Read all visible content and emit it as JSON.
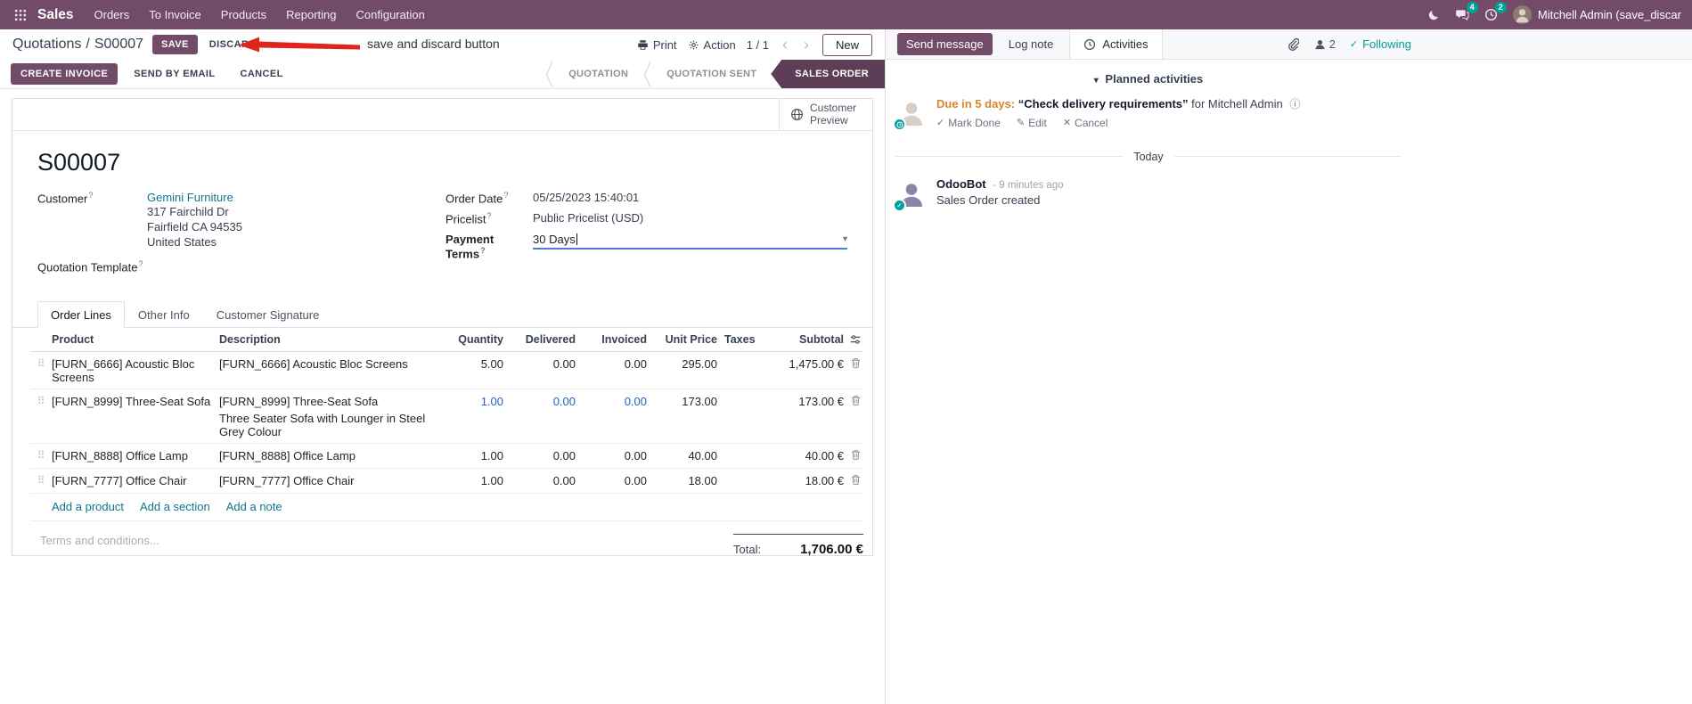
{
  "colors": {
    "primary": "#714B67",
    "status_active": "#5e3d57",
    "link": "#0e7490",
    "link_blue": "#2563c4",
    "warning_text": "#d8862c",
    "badge_green": "#00a09d",
    "annotation_red": "#e0261c"
  },
  "icons": {
    "help": "?",
    "caret_down": "▾",
    "chevron_left": "‹",
    "chevron_right": "›",
    "drag_handle": "⠿",
    "info": "ⓘ",
    "check": "✓",
    "edit": "✎",
    "cancel_x": "✕"
  },
  "navbar": {
    "brand": "Sales",
    "menus": [
      "Orders",
      "To Invoice",
      "Products",
      "Reporting",
      "Configuration"
    ],
    "message_badge": "4",
    "activity_badge": "2",
    "user_name": "Mitchell Admin (save_discar"
  },
  "control_panel": {
    "breadcrumb_parent": "Quotations",
    "breadcrumb_sep": "/",
    "breadcrumb_current": "S00007",
    "save_label": "SAVE",
    "discard_label": "DISCARD",
    "annotation_text": "save and discard button",
    "print_label": "Print",
    "action_label": "Action",
    "pager": "1 / 1",
    "new_label": "New"
  },
  "statusbar": {
    "create_invoice": "CREATE INVOICE",
    "send_by_email": "SEND BY EMAIL",
    "cancel": "CANCEL",
    "states": [
      {
        "label": "QUOTATION"
      },
      {
        "label": "QUOTATION SENT"
      },
      {
        "label": "SALES ORDER"
      }
    ]
  },
  "sheet": {
    "customer_preview": "Customer Preview",
    "title": "S00007",
    "fields": {
      "customer_label": "Customer",
      "customer_name": "Gemini Furniture",
      "address_line1": "317 Fairchild Dr",
      "address_line2": "Fairfield CA 94535",
      "address_line3": "United States",
      "quotation_template_label": "Quotation Template",
      "order_date_label": "Order Date",
      "order_date_value": "05/25/2023 15:40:01",
      "pricelist_label": "Pricelist",
      "pricelist_value": "Public Pricelist (USD)",
      "payment_terms_label": "Payment Terms",
      "payment_terms_value": "30 Days"
    },
    "tabs": [
      {
        "label": "Order Lines"
      },
      {
        "label": "Other Info"
      },
      {
        "label": "Customer Signature"
      }
    ],
    "table": {
      "headers": {
        "product": "Product",
        "description": "Description",
        "quantity": "Quantity",
        "delivered": "Delivered",
        "invoiced": "Invoiced",
        "unit_price": "Unit Price",
        "taxes": "Taxes",
        "subtotal": "Subtotal"
      },
      "rows": [
        {
          "product": "[FURN_6666] Acoustic Bloc Screens",
          "description": "[FURN_6666] Acoustic Bloc Screens",
          "description2": "",
          "quantity": "5.00",
          "delivered": "0.00",
          "invoiced": "0.00",
          "unit_price": "295.00",
          "taxes": "",
          "subtotal": "1,475.00 €"
        },
        {
          "product": "[FURN_8999] Three-Seat Sofa",
          "description": "[FURN_8999] Three-Seat Sofa",
          "description2": "Three Seater Sofa with Lounger in Steel Grey Colour",
          "quantity": "1.00",
          "delivered": "0.00",
          "invoiced": "0.00",
          "unit_price": "173.00",
          "taxes": "",
          "subtotal": "173.00 €"
        },
        {
          "product": "[FURN_8888] Office Lamp",
          "description": "[FURN_8888] Office Lamp",
          "description2": "",
          "quantity": "1.00",
          "delivered": "0.00",
          "invoiced": "0.00",
          "unit_price": "40.00",
          "taxes": "",
          "subtotal": "40.00 €"
        },
        {
          "product": "[FURN_7777] Office Chair",
          "description": "[FURN_7777] Office Chair",
          "description2": "",
          "quantity": "1.00",
          "delivered": "0.00",
          "invoiced": "0.00",
          "unit_price": "18.00",
          "taxes": "",
          "subtotal": "18.00 €"
        }
      ],
      "add_product": "Add a product",
      "add_section": "Add a section",
      "add_note": "Add a note"
    },
    "terms_placeholder": "Terms and conditions...",
    "total_label": "Total:",
    "total_value": "1,706.00 €"
  },
  "chatter": {
    "send_message": "Send message",
    "log_note": "Log note",
    "activities": "Activities",
    "followers_count": "2",
    "following": "Following",
    "planned_header": "Planned activities",
    "activity": {
      "due": "Due in 5 days:",
      "summary": "“Check delivery requirements”",
      "assignee": "for Mitchell Admin",
      "mark_done": "Mark Done",
      "edit": "Edit",
      "cancel": "Cancel"
    },
    "date_divider": "Today",
    "message": {
      "author": "OdooBot",
      "time": "- 9 minutes ago",
      "body": "Sales Order created"
    }
  }
}
